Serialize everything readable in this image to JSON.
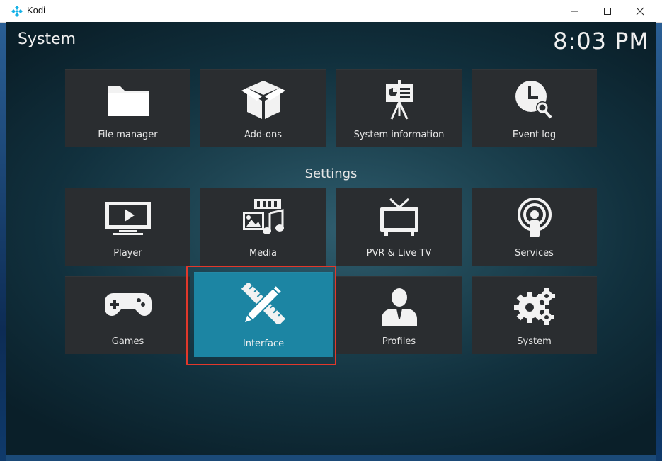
{
  "window": {
    "title": "Kodi",
    "logo_icon": "kodi-logo-icon",
    "controls": [
      "minimize-icon",
      "maximize-icon",
      "close-icon"
    ]
  },
  "header": {
    "title": "System",
    "clock": "8:03 PM"
  },
  "top_tiles": [
    {
      "label": "File manager",
      "icon": "folder-icon"
    },
    {
      "label": "Add-ons",
      "icon": "open-box-icon"
    },
    {
      "label": "System information",
      "icon": "presentation-board-icon"
    },
    {
      "label": "Event log",
      "icon": "clock-search-icon"
    }
  ],
  "settings": {
    "heading": "Settings",
    "tiles": [
      {
        "label": "Player",
        "icon": "monitor-play-icon"
      },
      {
        "label": "Media",
        "icon": "media-icon"
      },
      {
        "label": "PVR & Live TV",
        "icon": "tv-antenna-icon"
      },
      {
        "label": "Services",
        "icon": "broadcast-icon"
      },
      {
        "label": "Games",
        "icon": "gamepad-icon"
      },
      {
        "label": "Interface",
        "icon": "pencil-ruler-icon",
        "focused": true
      },
      {
        "label": "Profiles",
        "icon": "person-icon"
      },
      {
        "label": "System",
        "icon": "gears-icon"
      }
    ]
  },
  "colors": {
    "tile": "#2a2d30",
    "focus": "#1c85a3",
    "highlight_border": "#e2382b",
    "text": "#e8e8e8"
  }
}
